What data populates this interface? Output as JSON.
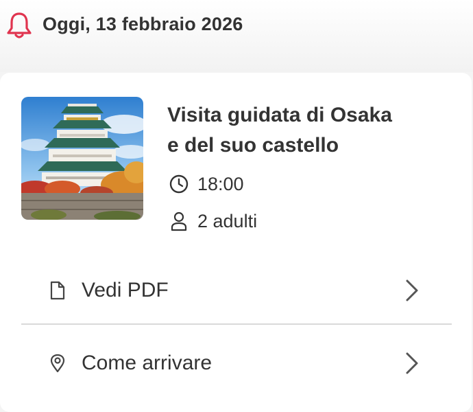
{
  "header": {
    "date_title": "Oggi, 13 febbraio 2026",
    "icon": "bell-icon",
    "accent_color": "#e0344f"
  },
  "booking": {
    "title_line1": "Visita guidata di Osaka",
    "title_line2": "e del suo castello",
    "time": "18:00",
    "time_icon": "clock-icon",
    "guests": "2 adulti",
    "guests_icon": "user-icon",
    "image": "osaka-castle-photo"
  },
  "actions": [
    {
      "label": "Vedi PDF",
      "icon": "document-icon"
    },
    {
      "label": "Come arrivare",
      "icon": "location-pin-icon"
    }
  ]
}
